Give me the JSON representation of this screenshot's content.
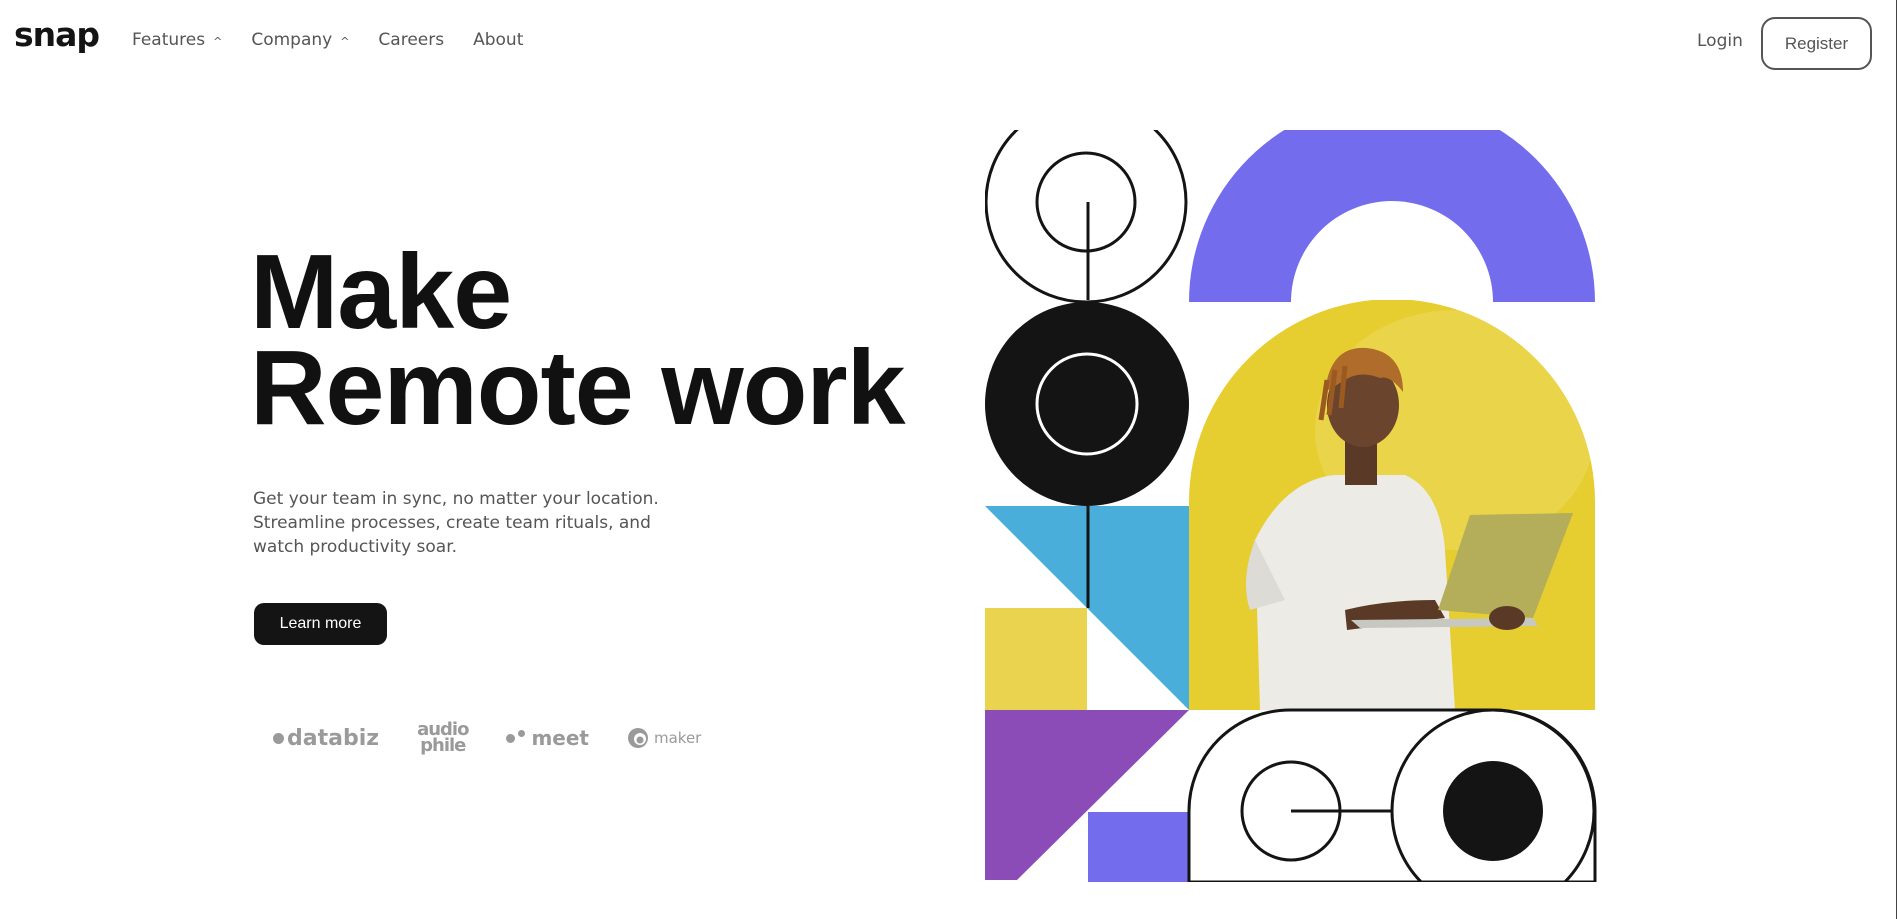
{
  "header": {
    "logo": "snap",
    "nav": [
      {
        "label": "Features",
        "caret": "^"
      },
      {
        "label": "Company",
        "caret": "^"
      },
      {
        "label": "Careers"
      },
      {
        "label": "About"
      }
    ],
    "login_label": "Login",
    "register_label": "Register"
  },
  "hero": {
    "title_line1": "Make",
    "title_line2": "Remote work",
    "description": "Get your team in sync, no matter your location. Streamline processes, create team rituals, and watch productivity soar.",
    "cta_label": "Learn more"
  },
  "clients": {
    "databiz": "databiz",
    "audiophile_top": "audio",
    "audiophile_bottom": "phile",
    "meet": "meet",
    "maker": "maker"
  },
  "colors": {
    "dark": "#141414",
    "purple": "#736ded",
    "violet": "#8c4cb8",
    "blue": "#4aaedb",
    "yellow": "#e9d34f",
    "photo_bg": "#e6cd30"
  }
}
